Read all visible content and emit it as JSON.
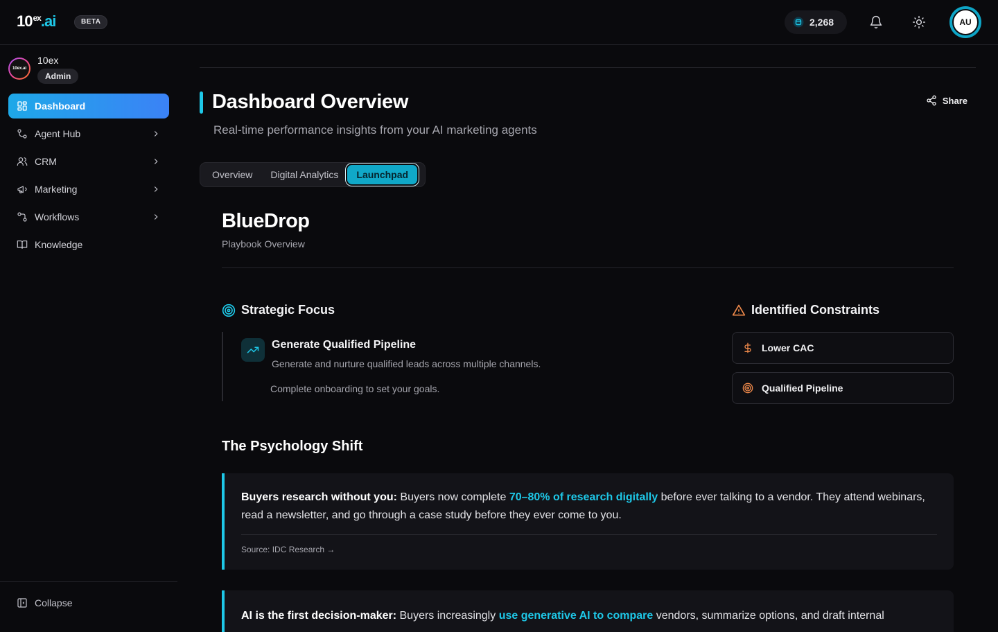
{
  "header": {
    "logo_main": "10",
    "logo_sup": "ex",
    "logo_suffix": ".ai",
    "beta": "BETA",
    "credits": "2,268",
    "avatar_initials": "AU",
    "icons": [
      "credits-icon",
      "bell-icon",
      "sun-icon"
    ]
  },
  "sidebar": {
    "org_name": "10ex",
    "org_logo_text": "10ex.ai",
    "role": "Admin",
    "items": [
      {
        "label": "Dashboard",
        "icon": "dashboard-icon",
        "active": true
      },
      {
        "label": "Agent Hub",
        "icon": "agent-hub-icon",
        "has_children": true
      },
      {
        "label": "CRM",
        "icon": "users-icon",
        "has_children": true
      },
      {
        "label": "Marketing",
        "icon": "megaphone-icon",
        "has_children": true
      },
      {
        "label": "Workflows",
        "icon": "workflow-icon",
        "has_children": true
      },
      {
        "label": "Knowledge",
        "icon": "book-icon"
      }
    ],
    "collapse_label": "Collapse"
  },
  "main": {
    "title": "Dashboard Overview",
    "subtitle": "Real-time performance insights from your AI marketing agents",
    "share_label": "Share",
    "tabs": [
      {
        "label": "Overview"
      },
      {
        "label": "Digital Analytics"
      },
      {
        "label": "Launchpad",
        "active": true
      }
    ],
    "brand": "BlueDrop",
    "brand_sub": "Playbook Overview",
    "strategic_focus": {
      "heading": "Strategic Focus",
      "goal_title": "Generate Qualified Pipeline",
      "goal_desc": "Generate and nurture qualified leads across multiple channels.",
      "goal_note": "Complete onboarding to set your goals."
    },
    "constraints": {
      "heading": "Identified Constraints",
      "items": [
        {
          "label": "Lower CAC",
          "icon": "dollar-icon"
        },
        {
          "label": "Qualified Pipeline",
          "icon": "target-icon"
        }
      ]
    },
    "psychology": {
      "heading": "The Psychology Shift",
      "cards": [
        {
          "lead": "Buyers research without you:",
          "pre": " Buyers now complete ",
          "highlight": "70–80% of research digitally",
          "post": " before ever talking to a vendor. They attend webinars, read a newsletter, and go through a case study before they ever come to you.",
          "source": "Source: IDC Research →"
        },
        {
          "lead": "AI is the first decision-maker:",
          "pre": " Buyers increasingly ",
          "highlight": "use generative AI to compare",
          "post": " vendors, summarize options, and draft internal"
        }
      ]
    }
  },
  "colors": {
    "accent": "#1ec8e8",
    "active_nav_start": "#1ea8e8",
    "active_nav_end": "#3b82f6",
    "warning": "#f08a4b",
    "background": "#0a0a0d"
  }
}
